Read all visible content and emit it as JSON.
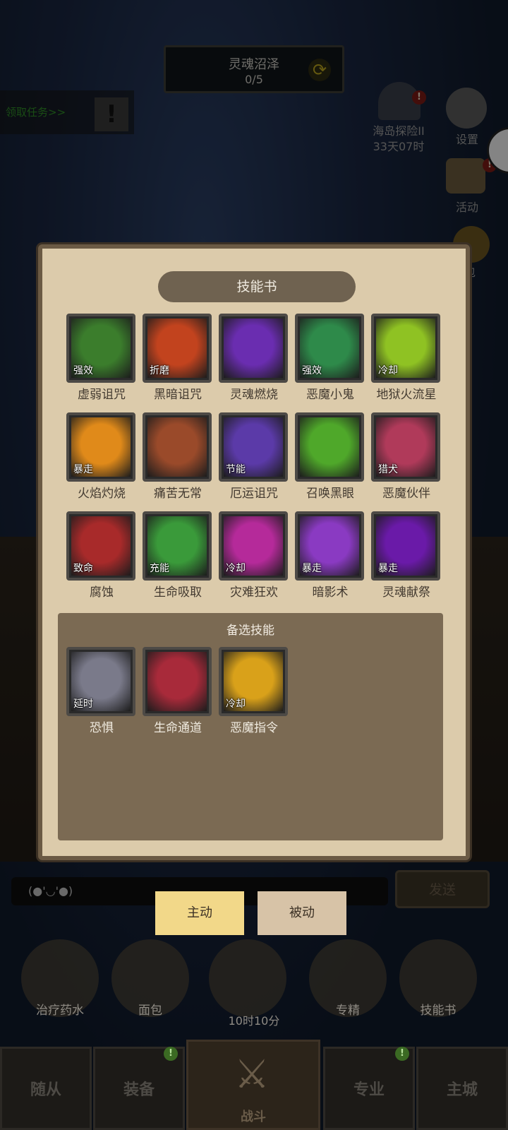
{
  "hud": {
    "quest_name": "灵魂沼泽",
    "quest_progress": "0/5",
    "task_link": "领取任务>>",
    "event_name": "海岛探险II",
    "event_timer": "33天07时",
    "settings_label": "设置",
    "activity_label": "活动",
    "bag_label": "包",
    "alert_mark": "!"
  },
  "modal": {
    "title": "技能书",
    "skills": [
      {
        "name": "虚弱诅咒",
        "tag": "强效",
        "icon": "sword-icon",
        "color": "#3b7d2c"
      },
      {
        "name": "黑暗诅咒",
        "tag": "折磨",
        "icon": "shield-crack-icon",
        "color": "#c2431e"
      },
      {
        "name": "灵魂燃烧",
        "tag": "",
        "icon": "skull-flame-icon",
        "color": "#6a2db0"
      },
      {
        "name": "恶魔小鬼",
        "tag": "强效",
        "icon": "imp-icon",
        "color": "#2e8a4a"
      },
      {
        "name": "地狱火流星",
        "tag": "冷却",
        "icon": "meteor-icon",
        "color": "#8fc223"
      },
      {
        "name": "火焰灼烧",
        "tag": "暴走",
        "icon": "fire-hand-icon",
        "color": "#e08a1a"
      },
      {
        "name": "痛苦无常",
        "tag": "",
        "icon": "scream-icon",
        "color": "#9a4a2a"
      },
      {
        "name": "厄运诅咒",
        "tag": "节能",
        "icon": "doom-orb-icon",
        "color": "#5b3aa8"
      },
      {
        "name": "召唤黑眼",
        "tag": "",
        "icon": "eye-demon-icon",
        "color": "#4fa82a"
      },
      {
        "name": "恶魔伙伴",
        "tag": "猎犬",
        "icon": "demon-dog-icon",
        "color": "#b03a5a"
      },
      {
        "name": "腐蚀",
        "tag": "致命",
        "icon": "corrupt-hand-icon",
        "color": "#a82a2a"
      },
      {
        "name": "生命吸取",
        "tag": "充能",
        "icon": "drain-hand-icon",
        "color": "#3a9a3a"
      },
      {
        "name": "灾难狂欢",
        "tag": "冷却",
        "icon": "chaos-icon",
        "color": "#b52a9a"
      },
      {
        "name": "暗影术",
        "tag": "暴走",
        "icon": "shadow-staff-icon",
        "color": "#8a3ac2"
      },
      {
        "name": "灵魂献祭",
        "tag": "暴走",
        "icon": "raven-icon",
        "color": "#6a1aa8"
      }
    ],
    "reserve_title": "备选技能",
    "reserve_skills": [
      {
        "name": "恐惧",
        "tag": "延时",
        "icon": "fear-mask-icon",
        "color": "#7a7a8a"
      },
      {
        "name": "生命通道",
        "tag": "",
        "icon": "life-channel-icon",
        "color": "#a82a3a"
      },
      {
        "name": "恶魔指令",
        "tag": "冷却",
        "icon": "demon-head-icon",
        "color": "#d9a11a"
      }
    ]
  },
  "tabs": {
    "active": "主动",
    "inactive": "被动"
  },
  "chat": {
    "placeholder": "(●'◡'●)",
    "send": "发送"
  },
  "actions": [
    {
      "label": "治疗药水",
      "icon": "potion-icon"
    },
    {
      "label": "面包",
      "icon": "bread-icon"
    },
    {
      "label": "",
      "icon": "chest-icon"
    },
    {
      "label": "专精",
      "icon": "specialty-icon"
    },
    {
      "label": "技能书",
      "icon": "skillbook-icon"
    }
  ],
  "timer": "10时10分",
  "nav": {
    "followers": "随从",
    "equipment": "装备",
    "battle": "战斗",
    "profession": "专业",
    "city": "主城"
  }
}
